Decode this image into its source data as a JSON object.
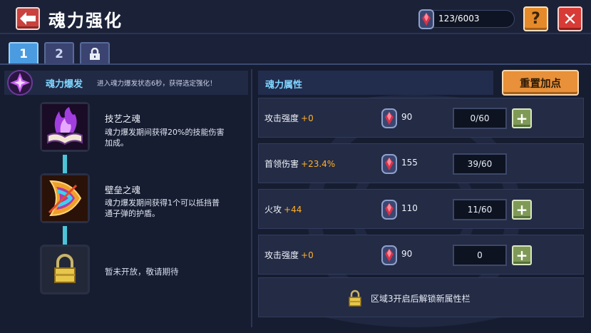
{
  "header": {
    "title": "魂力强化",
    "back_icon": "arrow-left-icon",
    "currency": {
      "icon": "soul-gem-icon",
      "value": "123/6003"
    },
    "help_label": "?",
    "close_label": "✕"
  },
  "tabs": [
    {
      "label": "1",
      "active": true
    },
    {
      "label": "2",
      "active": false
    },
    {
      "label": "",
      "icon": "lock-icon",
      "active": false
    }
  ],
  "burst": {
    "title": "魂力爆发",
    "description": "进入魂力爆发状态6秒，获得选定强化！"
  },
  "skills": [
    {
      "name": "技艺之魂",
      "desc_line1": "魂力爆发期间获得20%的技能伤害",
      "desc_line2": "加成。",
      "icon": "purple-flame-book-icon"
    },
    {
      "name": "壁垒之魂",
      "desc_line1": "魂力爆发期间获得1个可以抵挡普",
      "desc_line2": "通子弹的护盾。",
      "icon": "shield-bow-icon"
    },
    {
      "locked_text": "暂未开放，敬请期待",
      "icon": "lock-icon"
    }
  ],
  "attributes": {
    "title": "魂力属性",
    "reset_label": "重置加点",
    "rows": [
      {
        "label": "攻击强度",
        "bonus": "+0",
        "cost": "90",
        "level": "0/60",
        "can_add": true
      },
      {
        "label": "首领伤害",
        "bonus": "+23.4%",
        "cost": "155",
        "level": "39/60",
        "can_add": false
      },
      {
        "label": "火攻",
        "bonus": "+44",
        "cost": "110",
        "level": "11/60",
        "can_add": true
      },
      {
        "label": "攻击强度",
        "bonus": "+0",
        "cost": "90",
        "level": "0",
        "can_add": true
      }
    ],
    "unlock_text": "区域3开启后解锁新属性栏"
  },
  "colors": {
    "accent_cyan": "#7fd6ff",
    "bonus_orange": "#ffb02e",
    "reset_orange": "#e8913a",
    "close_red": "#d83b35",
    "plus_green": "#7f9a57"
  }
}
